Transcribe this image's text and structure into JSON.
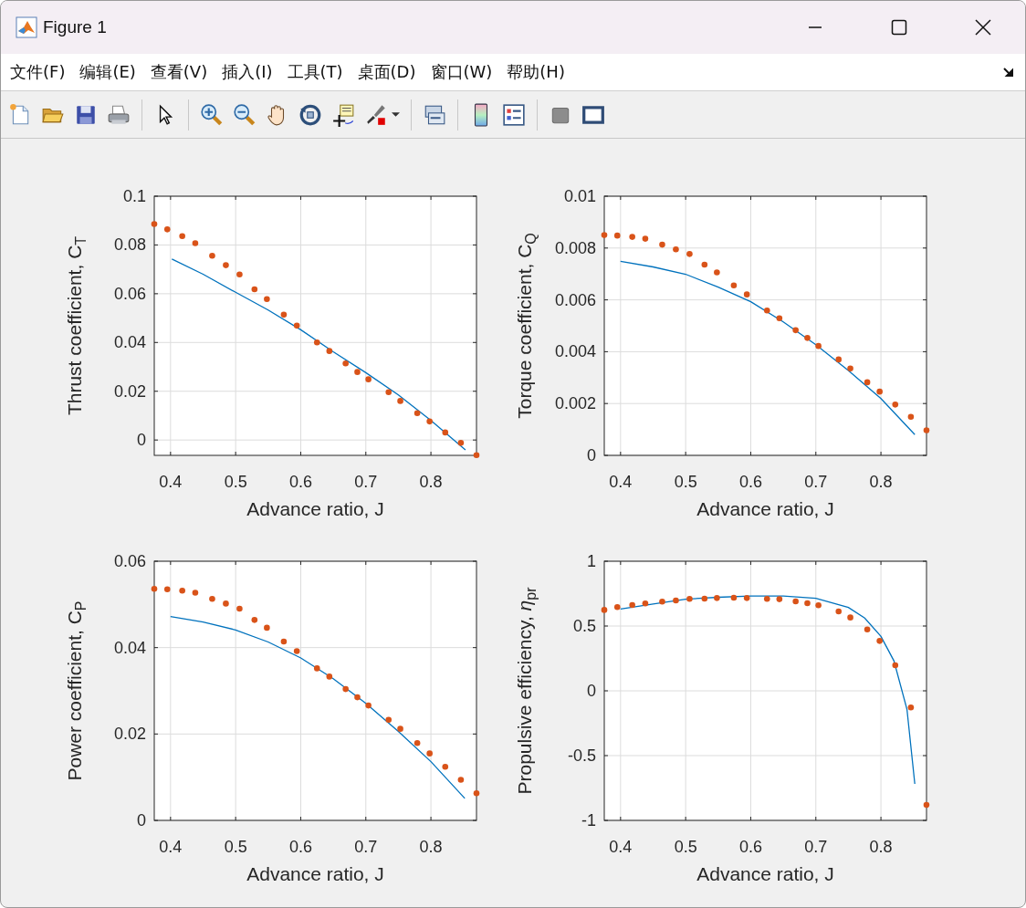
{
  "window": {
    "title": "Figure 1"
  },
  "menu": [
    "文件(F)",
    "编辑(E)",
    "查看(V)",
    "插入(I)",
    "工具(T)",
    "桌面(D)",
    "窗口(W)",
    "帮助(H)"
  ],
  "charts": [
    {
      "chart_data": {
        "type": "line",
        "xlabel": "Advance ratio, J",
        "ylabel": "Thrust coefficient, C$_{T}$",
        "xlim": [
          0.375,
          0.87
        ],
        "ylim": [
          -0.0063,
          0.1
        ],
        "grid": true,
        "xticks": [
          0.4,
          0.5,
          0.6,
          0.7,
          0.8
        ],
        "yticks": [
          0,
          0.02,
          0.04,
          0.06,
          0.08,
          0.1
        ],
        "series": [
          {
            "type": "line",
            "color": "#0072bd",
            "x": [
              0.402,
              0.45,
              0.5,
              0.55,
              0.6,
              0.65,
              0.7,
              0.75,
              0.8,
              0.853
            ],
            "values": [
              0.0742,
              0.068,
              0.0606,
              0.0533,
              0.0452,
              0.0362,
              0.0276,
              0.0185,
              0.008,
              -0.0041
            ]
          },
          {
            "type": "scatter",
            "color": "#d95319",
            "x": [
              0.375,
              0.395,
              0.418,
              0.438,
              0.464,
              0.485,
              0.506,
              0.529,
              0.548,
              0.574,
              0.594,
              0.625,
              0.644,
              0.669,
              0.687,
              0.704,
              0.735,
              0.753,
              0.779,
              0.798,
              0.822,
              0.846,
              0.87
            ],
            "values": [
              0.0886,
              0.0864,
              0.0836,
              0.0807,
              0.0756,
              0.0717,
              0.0679,
              0.0618,
              0.0578,
              0.0514,
              0.0469,
              0.04,
              0.0365,
              0.0314,
              0.0279,
              0.0249,
              0.0196,
              0.016,
              0.011,
              0.0076,
              0.0031,
              -0.0012,
              -0.0062
            ]
          }
        ]
      }
    },
    {
      "chart_data": {
        "type": "line",
        "xlabel": "Advance ratio, J",
        "ylabel": "Torque coefficient, C$_{Q}$",
        "xlim": [
          0.375,
          0.87
        ],
        "ylim": [
          0,
          0.01
        ],
        "grid": true,
        "xticks": [
          0.4,
          0.5,
          0.6,
          0.7,
          0.8
        ],
        "yticks": [
          0,
          0.002,
          0.004,
          0.006,
          0.008,
          0.01
        ],
        "series": [
          {
            "type": "line",
            "color": "#0072bd",
            "x": [
              0.4,
              0.45,
              0.5,
              0.55,
              0.6,
              0.65,
              0.7,
              0.75,
              0.8,
              0.852
            ],
            "values": [
              0.00749,
              0.00727,
              0.00699,
              0.00649,
              0.00593,
              0.00515,
              0.00427,
              0.00327,
              0.00219,
              0.0008
            ]
          },
          {
            "type": "scatter",
            "color": "#d95319",
            "x": [
              0.375,
              0.395,
              0.418,
              0.438,
              0.464,
              0.485,
              0.506,
              0.529,
              0.548,
              0.574,
              0.594,
              0.625,
              0.644,
              0.669,
              0.687,
              0.704,
              0.735,
              0.753,
              0.779,
              0.798,
              0.822,
              0.846,
              0.87
            ],
            "values": [
              0.0085,
              0.00848,
              0.00843,
              0.00836,
              0.00813,
              0.00795,
              0.00777,
              0.00736,
              0.00706,
              0.00656,
              0.00621,
              0.00559,
              0.00529,
              0.00483,
              0.00453,
              0.00422,
              0.0037,
              0.00335,
              0.00282,
              0.00246,
              0.00196,
              0.00149,
              0.00097
            ]
          }
        ]
      }
    },
    {
      "chart_data": {
        "type": "line",
        "xlabel": "Advance ratio, J",
        "ylabel": "Power coefficient, C$_{P}$",
        "xlim": [
          0.375,
          0.87
        ],
        "ylim": [
          0,
          0.06
        ],
        "grid": true,
        "xticks": [
          0.4,
          0.5,
          0.6,
          0.7,
          0.8
        ],
        "yticks": [
          0,
          0.02,
          0.04,
          0.06
        ],
        "series": [
          {
            "type": "line",
            "color": "#0072bd",
            "x": [
              0.4,
              0.45,
              0.5,
              0.55,
              0.6,
              0.65,
              0.7,
              0.75,
              0.8,
              0.852
            ],
            "values": [
              0.0472,
              0.0459,
              0.0441,
              0.0413,
              0.0376,
              0.0328,
              0.0271,
              0.0206,
              0.0136,
              0.0051
            ]
          },
          {
            "type": "scatter",
            "color": "#d95319",
            "x": [
              0.375,
              0.395,
              0.418,
              0.438,
              0.464,
              0.485,
              0.506,
              0.529,
              0.548,
              0.574,
              0.594,
              0.625,
              0.644,
              0.669,
              0.687,
              0.704,
              0.735,
              0.753,
              0.779,
              0.798,
              0.822,
              0.846,
              0.87
            ],
            "values": [
              0.0536,
              0.0535,
              0.0532,
              0.0527,
              0.0513,
              0.0502,
              0.049,
              0.0464,
              0.0446,
              0.0414,
              0.0392,
              0.0352,
              0.0333,
              0.0304,
              0.0285,
              0.0266,
              0.0233,
              0.0212,
              0.0179,
              0.0155,
              0.0124,
              0.0094,
              0.0063
            ]
          }
        ]
      }
    },
    {
      "chart_data": {
        "type": "line",
        "xlabel": "Advance ratio, J",
        "ylabel": "Propulsive efficiency, *η*$_{pr}$",
        "xlim": [
          0.375,
          0.87
        ],
        "ylim": [
          -1,
          1
        ],
        "grid": true,
        "xticks": [
          0.4,
          0.5,
          0.6,
          0.7,
          0.8
        ],
        "yticks": [
          -1,
          -0.5,
          0,
          0.5,
          1
        ],
        "series": [
          {
            "type": "line",
            "color": "#0072bd",
            "x": [
              0.4,
              0.45,
              0.5,
              0.55,
              0.6,
              0.65,
              0.7,
              0.75,
              0.775,
              0.8,
              0.82,
              0.84,
              0.852
            ],
            "values": [
              0.631,
              0.67,
              0.707,
              0.722,
              0.732,
              0.732,
              0.714,
              0.643,
              0.561,
              0.42,
              0.232,
              -0.143,
              -0.718
            ]
          },
          {
            "type": "scatter",
            "color": "#d95319",
            "x": [
              0.375,
              0.395,
              0.418,
              0.438,
              0.464,
              0.485,
              0.506,
              0.529,
              0.548,
              0.574,
              0.594,
              0.625,
              0.644,
              0.669,
              0.687,
              0.704,
              0.735,
              0.753,
              0.779,
              0.798,
              0.822,
              0.846,
              0.87
            ],
            "values": [
              0.624,
              0.646,
              0.662,
              0.674,
              0.688,
              0.697,
              0.709,
              0.711,
              0.716,
              0.718,
              0.716,
              0.709,
              0.707,
              0.69,
              0.676,
              0.66,
              0.613,
              0.566,
              0.474,
              0.385,
              0.197,
              -0.129,
              -0.88
            ]
          }
        ]
      }
    }
  ]
}
